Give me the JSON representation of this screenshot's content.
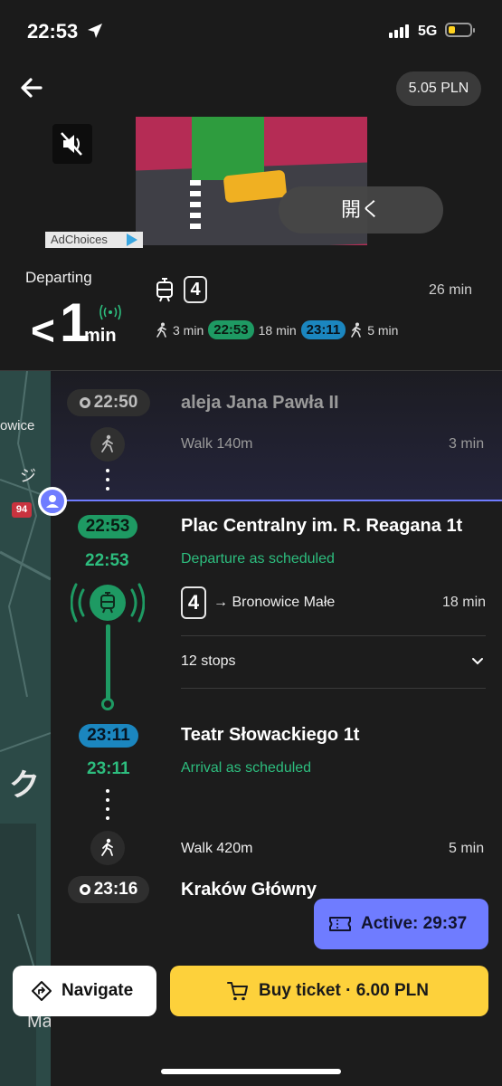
{
  "status": {
    "time": "22:53",
    "network": "5G"
  },
  "header": {
    "price": "5.05 PLN"
  },
  "ad": {
    "choices_label": "AdChoices",
    "open_label": "開く"
  },
  "departure": {
    "label": "Departing",
    "arrow": "<",
    "value": "1",
    "unit": "min",
    "line": "4",
    "duration": "26 min",
    "legs": {
      "walk1": "3 min",
      "dep_time": "22:53",
      "ride": "18 min",
      "arr_time": "23:11",
      "walk2": "5 min"
    }
  },
  "map": {
    "label_top": "owice",
    "label_mid": "ジ",
    "road": "94",
    "label_big": "ク",
    "label_bottom": "Ma"
  },
  "timeline": {
    "start": {
      "time": "22:50",
      "name": "aleja Jana Pawła II",
      "walk": "Walk 140m",
      "walk_duration": "3 min"
    },
    "board": {
      "time": "22:53",
      "realtime": "22:53",
      "name": "Plac Centralny im. R. Reagana 1t",
      "status": "Departure as scheduled",
      "line": "4",
      "direction": "→ Bronowice Małe",
      "duration": "18 min",
      "stops": "12 stops"
    },
    "alight": {
      "time": "23:11",
      "realtime": "23:11",
      "name": "Teatr Słowackiego 1t",
      "status": "Arrival as scheduled",
      "walk": "Walk 420m",
      "walk_duration": "5 min"
    },
    "end": {
      "time": "23:16",
      "name": "Kraków Główny"
    }
  },
  "actions": {
    "active_label": "Active: 29:37",
    "navigate_label": "Navigate",
    "buy_label": "Buy ticket · 6.00 PLN"
  },
  "colors": {
    "green": "#1e9a63",
    "blue": "#1b86bf",
    "accent": "#6f7cff",
    "yellow": "#fdd13b"
  }
}
